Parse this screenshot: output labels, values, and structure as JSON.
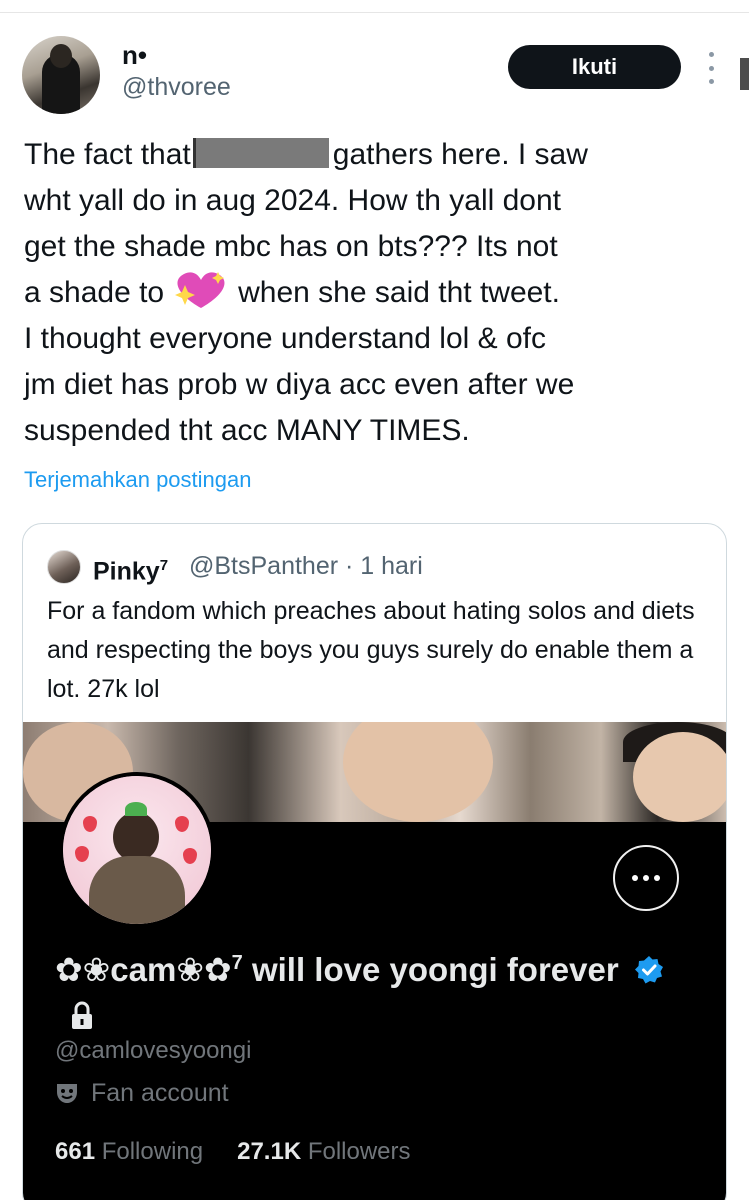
{
  "post": {
    "display_name": "n•",
    "handle": "@thvoree",
    "follow_label": "Ikuti",
    "text_lines": [
      "The fact that",
      "gathers here. I saw",
      "wht yall do in aug 2024. How th yall dont",
      "get the shade mbc has on bts??? Its not",
      "a shade to",
      "when she said tht tweet.",
      "I thought everyone understand lol & ofc",
      "jm diet has prob w diya acc even after we",
      "suspended tht acc MANY TIMES."
    ],
    "translate_label": "Terjemahkan postingan"
  },
  "quote": {
    "name": "Pinky",
    "name_sup": "7",
    "handle_time": "@BtsPanther · 1 hari",
    "text": "For a fandom which preaches about hating solos and diets and respecting the boys you guys surely do enable them a lot. 27k lol",
    "profile": {
      "name": "✿❀cam❀✿",
      "name_sup": "7",
      "name_rest": " will love yoongi forever",
      "handle": "@camlovesyoongi",
      "category": "Fan account",
      "following_count": "661",
      "following_label": "Following",
      "followers_count": "27.1K",
      "followers_label": "Followers"
    }
  },
  "colors": {
    "accent": "#1d9bf0",
    "button_bg": "#0f1419",
    "muted": "#536471"
  }
}
